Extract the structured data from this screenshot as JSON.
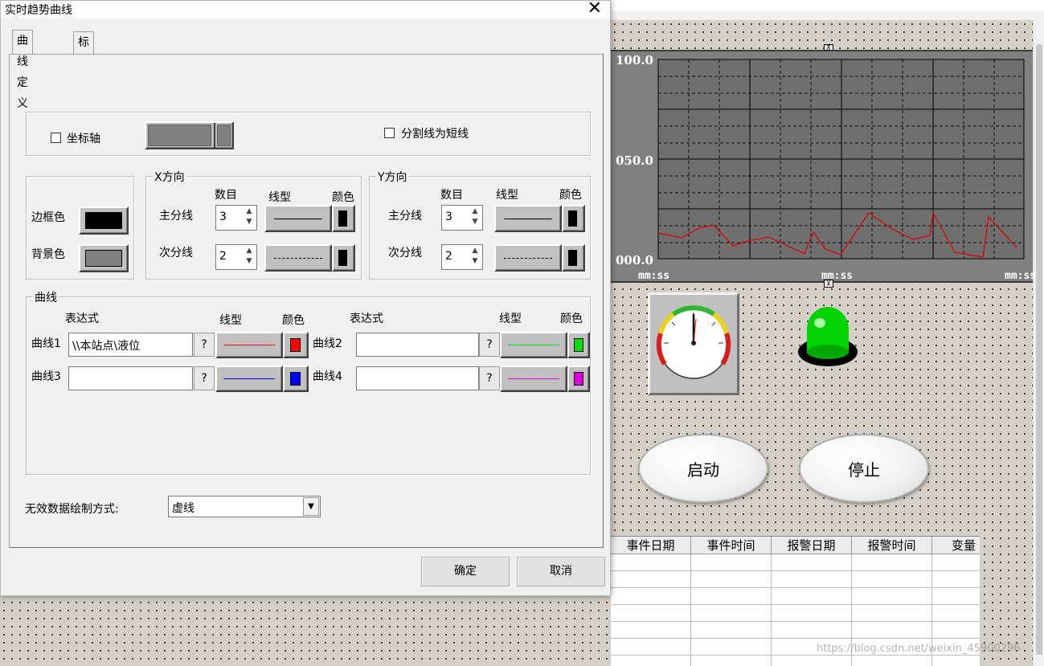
{
  "dialog": {
    "title": "实时趋势曲线",
    "close_symbol": "✕",
    "tabs": [
      {
        "label": "曲线定义",
        "active": true
      },
      {
        "label": "标识定义",
        "active": false
      }
    ],
    "axis_checkbox_label": "坐标轴",
    "short_divider_checkbox_label": "分割线为短线",
    "border_color_label": "边框色",
    "bg_color_label": "背景色",
    "x_group": {
      "title": "X方向",
      "count_header": "数目",
      "linetype_header": "线型",
      "color_header": "颜色",
      "major_label": "主分线",
      "major_count": "3",
      "minor_label": "次分线",
      "minor_count": "2"
    },
    "y_group": {
      "title": "Y方向",
      "count_header": "数目",
      "linetype_header": "线型",
      "color_header": "颜色",
      "major_label": "主分线",
      "major_count": "3",
      "minor_label": "次分线",
      "minor_count": "2"
    },
    "curve_group": {
      "title": "曲线",
      "expr_header": "表达式",
      "linetype_header": "线型",
      "color_header": "颜色",
      "question": "?",
      "curves": [
        {
          "label": "曲线1",
          "expression": "\\\\本站点\\液位",
          "color": "#ff0000"
        },
        {
          "label": "曲线2",
          "expression": "",
          "color": "#00e000"
        },
        {
          "label": "曲线3",
          "expression": "",
          "color": "#0000ff"
        },
        {
          "label": "曲线4",
          "expression": "",
          "color": "#e000e0"
        }
      ]
    },
    "invalid_data_label": "无效数据绘制方式:",
    "invalid_data_value": "虚线",
    "ok_label": "确定",
    "cancel_label": "取消"
  },
  "trend": {
    "y_labels": [
      "100.0",
      "050.0",
      "000.0"
    ],
    "x_labels": [
      "mm:ss",
      "mm:ss",
      "mm:ss"
    ],
    "handle_top": "⊼",
    "handle_bottom": "⊻"
  },
  "buttons": {
    "start_label": "启动",
    "stop_label": "停止"
  },
  "alarm_table": {
    "columns": [
      "事件日期",
      "事件时间",
      "报警日期",
      "报警时间",
      "变量"
    ]
  },
  "watermark": "https://blog.csdn.net/weixin_45900296"
}
